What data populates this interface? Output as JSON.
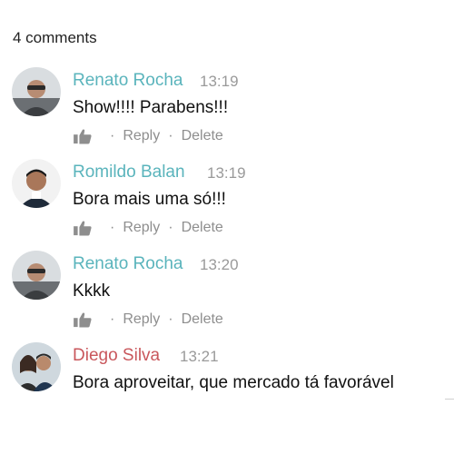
{
  "header": {
    "comments_count": "4 comments"
  },
  "colors": {
    "author_teal": "#5ab4bc",
    "author_red": "#c9575c",
    "meta_gray": "#8e8e8e"
  },
  "actions": {
    "like_icon": "thumbs-up-icon",
    "reply": "Reply",
    "delete": "Delete",
    "separator": "·"
  },
  "comments": [
    {
      "author": "Renato Rocha",
      "time": "13:19",
      "text": "Show!!!! Parabens!!!"
    },
    {
      "author": "Romildo Balan",
      "time": "13:19",
      "text": "Bora mais uma só!!!"
    },
    {
      "author": "Renato Rocha",
      "time": "13:20",
      "text": "Kkkk"
    },
    {
      "author": "Diego Silva",
      "time": "13:21",
      "text": "Bora aproveitar, que mercado tá favorável"
    }
  ]
}
